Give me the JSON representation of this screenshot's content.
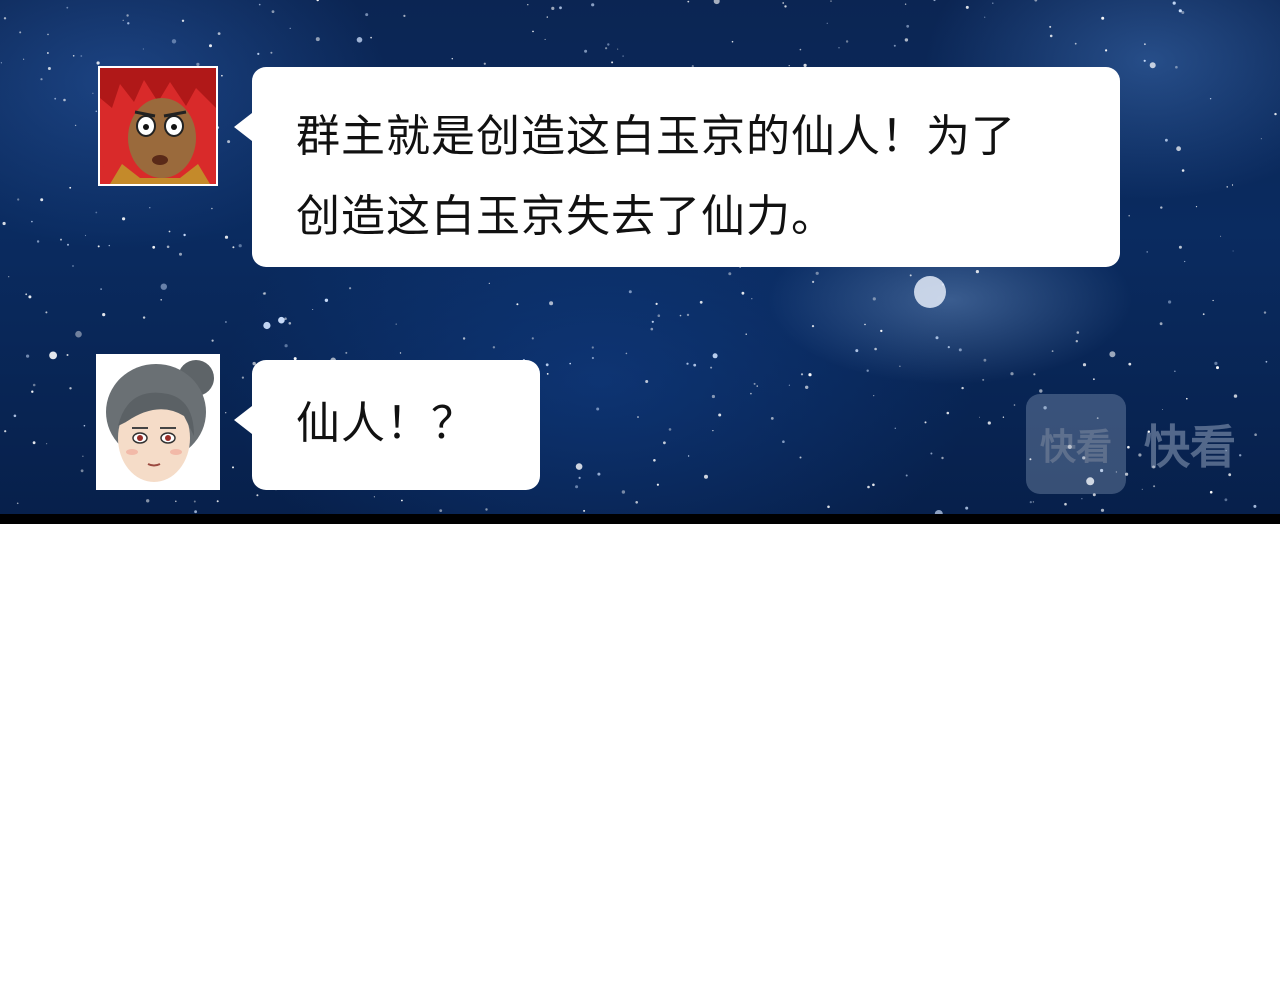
{
  "messages": [
    {
      "speaker": "red-haired man",
      "text": "群主就是创造这白玉京的仙人！为了创造这白玉京失去了仙力。"
    },
    {
      "speaker": "woman with hair bun",
      "text": "仙人！？"
    }
  ],
  "watermark": {
    "box_text": "快看",
    "text": "快看"
  }
}
